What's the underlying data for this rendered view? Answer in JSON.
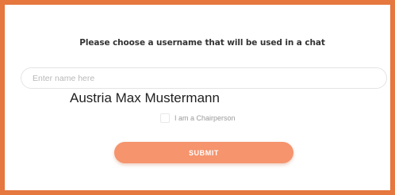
{
  "form": {
    "prompt": "Please choose a username that will be used in a chat",
    "name_placeholder": "Enter name here",
    "overlay_text": "Austria Max Mustermann",
    "checkbox_label": "I am a Chairperson",
    "submit_label": "SUBMIT"
  },
  "colors": {
    "frame_border": "#e5773f",
    "submit_bg": "#f5946d"
  }
}
